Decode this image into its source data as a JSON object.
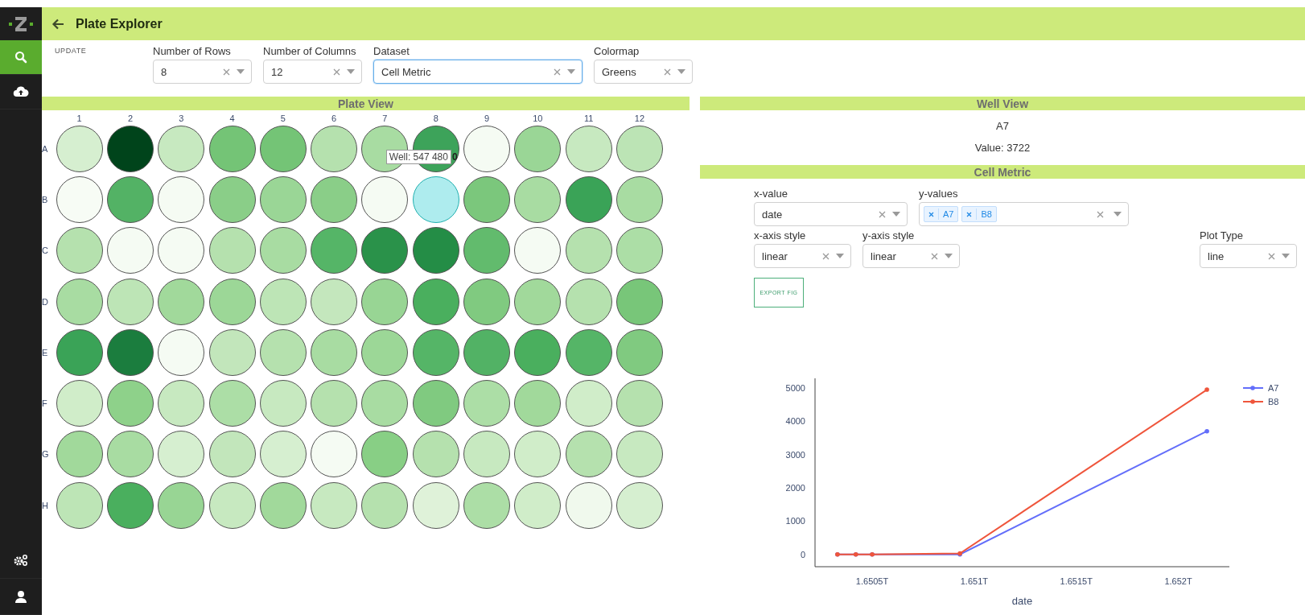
{
  "header": {
    "title": "Plate Explorer"
  },
  "sidebar": {
    "items": [
      {
        "kind": "search",
        "selected": true
      },
      {
        "kind": "upload",
        "selected": false
      }
    ],
    "bottom_items": [
      {
        "kind": "settings"
      },
      {
        "kind": "user"
      }
    ]
  },
  "controls": {
    "update_button": "UPDATE",
    "dropdowns": [
      {
        "label": "Number of Rows",
        "value": "8",
        "focused": false
      },
      {
        "label": "Number of Columns",
        "value": "12",
        "focused": false
      },
      {
        "label": "Dataset",
        "value": "Cell Metric",
        "focused": true
      },
      {
        "label": "Colormap",
        "value": "Greens",
        "focused": false
      }
    ]
  },
  "plate_view": {
    "title": "Plate View",
    "columns": [
      "1",
      "2",
      "3",
      "4",
      "5",
      "6",
      "7",
      "8",
      "9",
      "10",
      "11",
      "12"
    ],
    "rows": [
      {
        "label": "A",
        "wells": [
          {
            "color": "#d6efd0",
            "selected": false
          },
          {
            "color": "#00441b",
            "selected": false
          },
          {
            "color": "#c7e9c0",
            "selected": false
          },
          {
            "color": "#74c476",
            "selected": false
          },
          {
            "color": "#74c476",
            "selected": false
          },
          {
            "color": "#b5e1ae",
            "selected": false
          },
          {
            "color": "#a8dca2",
            "selected": false,
            "tooltip": "Well: 547 480",
            "tooltip_tail": "0"
          },
          {
            "color": "#3da35a",
            "selected": false
          },
          {
            "color": "#f5fbf3",
            "selected": false
          },
          {
            "color": "#9ad696",
            "selected": false
          },
          {
            "color": "#c7e9c0",
            "selected": false
          },
          {
            "color": "#bce4b5",
            "selected": false
          }
        ]
      },
      {
        "label": "B",
        "wells": [
          {
            "color": "#f7fcf5",
            "selected": false
          },
          {
            "color": "#53b265",
            "selected": false
          },
          {
            "color": "#f5fbf3",
            "selected": false
          },
          {
            "color": "#8ace88",
            "selected": false
          },
          {
            "color": "#9ad696",
            "selected": false
          },
          {
            "color": "#8ace88",
            "selected": false
          },
          {
            "color": "#f5fbf3",
            "selected": false
          },
          {
            "color": "#aeecee",
            "selected": true
          },
          {
            "color": "#7bc77c",
            "selected": false
          },
          {
            "color": "#a8dca2",
            "selected": false
          },
          {
            "color": "#3aa357",
            "selected": false
          },
          {
            "color": "#a8dca2",
            "selected": false
          }
        ]
      },
      {
        "label": "C",
        "wells": [
          {
            "color": "#b5e1ae",
            "selected": false
          },
          {
            "color": "#f5fbf3",
            "selected": false
          },
          {
            "color": "#f5fbf3",
            "selected": false
          },
          {
            "color": "#b5e1ae",
            "selected": false
          },
          {
            "color": "#a8dca2",
            "selected": false
          },
          {
            "color": "#55b567",
            "selected": false
          },
          {
            "color": "#2a924a",
            "selected": false
          },
          {
            "color": "#248d46",
            "selected": false
          },
          {
            "color": "#62bb6d",
            "selected": false
          },
          {
            "color": "#f5fbf3",
            "selected": false
          },
          {
            "color": "#b5e1ae",
            "selected": false
          },
          {
            "color": "#acdea6",
            "selected": false
          }
        ]
      },
      {
        "label": "D",
        "wells": [
          {
            "color": "#a8dca2",
            "selected": false
          },
          {
            "color": "#bde5b6",
            "selected": false
          },
          {
            "color": "#a1d99b",
            "selected": false
          },
          {
            "color": "#9cd797",
            "selected": false
          },
          {
            "color": "#bde5b6",
            "selected": false
          },
          {
            "color": "#c4e7bd",
            "selected": false
          },
          {
            "color": "#98d594",
            "selected": false
          },
          {
            "color": "#4aaf5e",
            "selected": false
          },
          {
            "color": "#80ca80",
            "selected": false
          },
          {
            "color": "#a1d99b",
            "selected": false
          },
          {
            "color": "#b5e1ae",
            "selected": false
          },
          {
            "color": "#78c679",
            "selected": false
          }
        ]
      },
      {
        "label": "E",
        "wells": [
          {
            "color": "#3aa357",
            "selected": false
          },
          {
            "color": "#1b7d3e",
            "selected": false
          },
          {
            "color": "#f5fbf3",
            "selected": false
          },
          {
            "color": "#c2e6bb",
            "selected": false
          },
          {
            "color": "#b5e1ae",
            "selected": false
          },
          {
            "color": "#a8dca2",
            "selected": false
          },
          {
            "color": "#9cd797",
            "selected": false
          },
          {
            "color": "#55b567",
            "selected": false
          },
          {
            "color": "#52b265",
            "selected": false
          },
          {
            "color": "#4aaf5e",
            "selected": false
          },
          {
            "color": "#55b567",
            "selected": false
          },
          {
            "color": "#80ca80",
            "selected": false
          }
        ]
      },
      {
        "label": "F",
        "wells": [
          {
            "color": "#d0edc9",
            "selected": false
          },
          {
            "color": "#8ed18a",
            "selected": false
          },
          {
            "color": "#c7e9c0",
            "selected": false
          },
          {
            "color": "#acdea6",
            "selected": false
          },
          {
            "color": "#c7e9c0",
            "selected": false
          },
          {
            "color": "#b5e1ae",
            "selected": false
          },
          {
            "color": "#a8dca2",
            "selected": false
          },
          {
            "color": "#80ca80",
            "selected": false
          },
          {
            "color": "#acdea6",
            "selected": false
          },
          {
            "color": "#a1d99b",
            "selected": false
          },
          {
            "color": "#d0edc9",
            "selected": false
          },
          {
            "color": "#b5e1ae",
            "selected": false
          }
        ]
      },
      {
        "label": "G",
        "wells": [
          {
            "color": "#a1d99b",
            "selected": false
          },
          {
            "color": "#a8dca2",
            "selected": false
          },
          {
            "color": "#d6efd0",
            "selected": false
          },
          {
            "color": "#c2e6bb",
            "selected": false
          },
          {
            "color": "#d6efd0",
            "selected": false
          },
          {
            "color": "#f5fbf3",
            "selected": false
          },
          {
            "color": "#88cf85",
            "selected": false
          },
          {
            "color": "#b5e1ae",
            "selected": false
          },
          {
            "color": "#c7e9c0",
            "selected": false
          },
          {
            "color": "#d0edc9",
            "selected": false
          },
          {
            "color": "#b5e1ae",
            "selected": false
          },
          {
            "color": "#c7e9c0",
            "selected": false
          }
        ]
      },
      {
        "label": "H",
        "wells": [
          {
            "color": "#bde5b6",
            "selected": false
          },
          {
            "color": "#4aaf5e",
            "selected": false
          },
          {
            "color": "#98d594",
            "selected": false
          },
          {
            "color": "#c7e9c0",
            "selected": false
          },
          {
            "color": "#a1d99b",
            "selected": false
          },
          {
            "color": "#c7e9c0",
            "selected": false
          },
          {
            "color": "#b5e1ae",
            "selected": false
          },
          {
            "color": "#dff2d9",
            "selected": false
          },
          {
            "color": "#acdea6",
            "selected": false
          },
          {
            "color": "#d0edc9",
            "selected": false
          },
          {
            "color": "#f0f9ed",
            "selected": false
          },
          {
            "color": "#d6efd0",
            "selected": false
          }
        ]
      }
    ]
  },
  "well_view": {
    "title": "Well View",
    "well": "A7",
    "value": "Value: 3722"
  },
  "cell_metric": {
    "title": "Cell Metric",
    "x_value": {
      "label": "x-value",
      "value": "date"
    },
    "y_values": {
      "label": "y-values",
      "tags": [
        "A7",
        "B8"
      ]
    },
    "x_axis_style": {
      "label": "x-axis style",
      "value": "linear"
    },
    "y_axis_style": {
      "label": "y-axis style",
      "value": "linear"
    },
    "plot_type": {
      "label": "Plot Type",
      "value": "line"
    },
    "export_button": "EXPORT FIG",
    "chart_data": {
      "type": "line",
      "xlabel": "date",
      "x": [
        1.65033,
        1.65042,
        1.6505,
        1.65093,
        1.65214
      ],
      "series": [
        {
          "name": "A7",
          "color": "#636efa",
          "values": [
            0,
            0,
            0,
            0,
            3700
          ]
        },
        {
          "name": "B8",
          "color": "#ef553b",
          "values": [
            0,
            0,
            0,
            30,
            4950
          ]
        }
      ],
      "xlim": [
        1.65022,
        1.65225
      ],
      "ylim": [
        -370,
        5290
      ],
      "xticks": [
        {
          "value": 1.6505,
          "label": "1.6505T"
        },
        {
          "value": 1.651,
          "label": "1.651T"
        },
        {
          "value": 1.6515,
          "label": "1.6515T"
        },
        {
          "value": 1.652,
          "label": "1.652T"
        }
      ],
      "yticks": [
        0,
        1000,
        2000,
        3000,
        4000,
        5000
      ],
      "legend": true
    }
  }
}
